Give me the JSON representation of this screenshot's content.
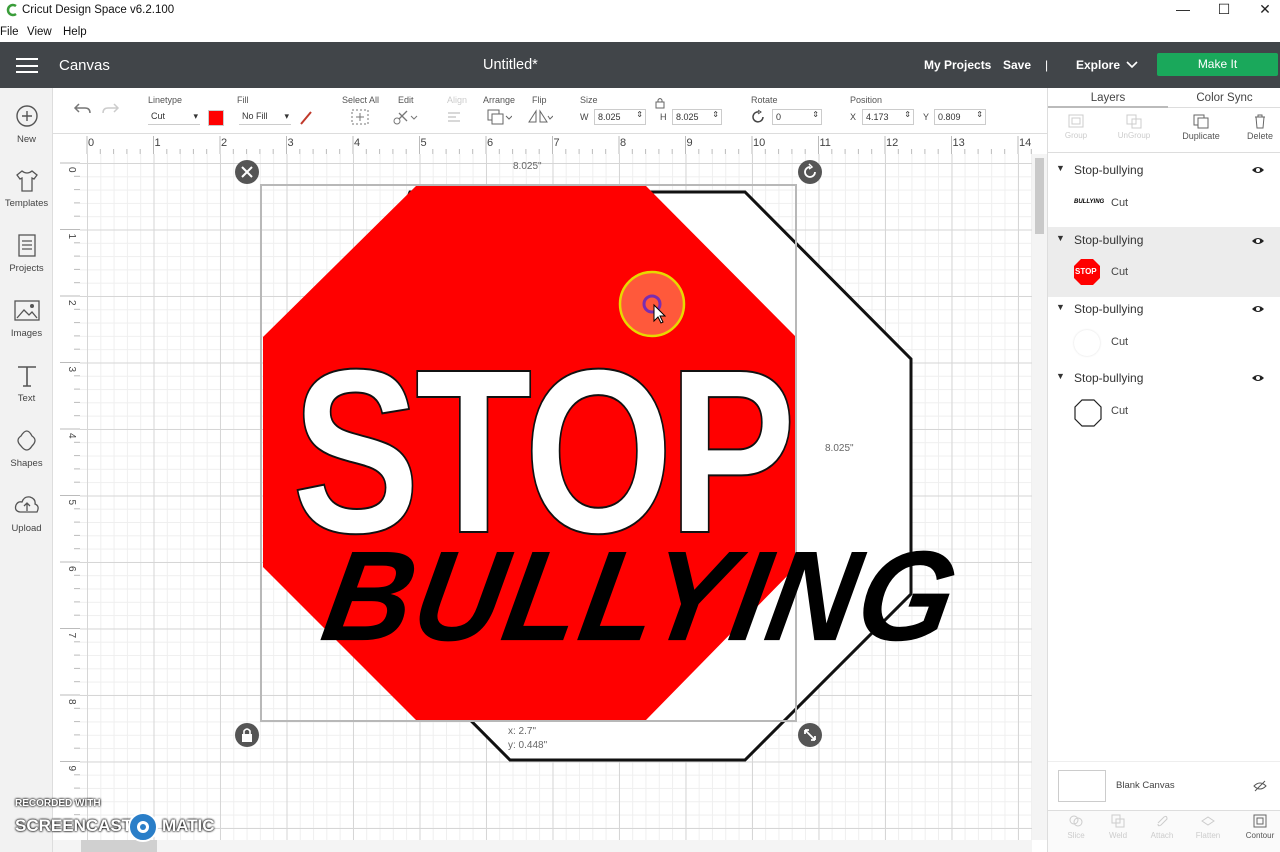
{
  "window": {
    "title": "Cricut Design Space  v6.2.100"
  },
  "menu": [
    "File",
    "View",
    "Help"
  ],
  "header": {
    "section": "Canvas",
    "document": "Untitled*",
    "my_projects": "My Projects",
    "save": "Save",
    "separator": "|",
    "explore": "Explore",
    "make_it": "Make It"
  },
  "sidebar": [
    {
      "label": "New",
      "icon": "plus-circle-icon"
    },
    {
      "label": "Templates",
      "icon": "tshirt-icon"
    },
    {
      "label": "Projects",
      "icon": "projects-icon"
    },
    {
      "label": "Images",
      "icon": "image-icon"
    },
    {
      "label": "Text",
      "icon": "text-icon"
    },
    {
      "label": "Shapes",
      "icon": "shapes-icon"
    },
    {
      "label": "Upload",
      "icon": "upload-icon"
    }
  ],
  "toolbar": {
    "linetype_label": "Linetype",
    "linetype_value": "Cut",
    "fill_label": "Fill",
    "fill_value": "No Fill",
    "select_all": "Select All",
    "edit": "Edit",
    "align": "Align",
    "arrange": "Arrange",
    "flip": "Flip",
    "size_label": "Size",
    "w_label": "W",
    "w_value": "8.025",
    "h_label": "H",
    "h_value": "8.025",
    "rotate_label": "Rotate",
    "rotate_value": "0",
    "position_label": "Position",
    "x_label": "X",
    "x_value": "4.173",
    "y_label": "Y",
    "y_value": "0.809",
    "linetype_color": "#ff0000"
  },
  "ruler": {
    "top": [
      "0",
      "1",
      "2",
      "3",
      "4",
      "5",
      "6",
      "7",
      "8",
      "9",
      "10",
      "11",
      "12",
      "13",
      "14"
    ],
    "left": [
      "0",
      "1",
      "2",
      "3",
      "4",
      "5",
      "6",
      "7",
      "8",
      "9"
    ]
  },
  "canvas": {
    "width_readout": "8.025\"",
    "height_readout": "8.025\"",
    "pos_x": "x: 2.7\"",
    "pos_y": "y: 0.448\"",
    "stop_text": "STOP",
    "bullying_text": "BULLYING",
    "red": "#ff0000"
  },
  "layers_panel": {
    "tab_layers": "Layers",
    "tab_color_sync": "Color Sync",
    "actions": [
      "Group",
      "UnGroup",
      "Duplicate",
      "Delete"
    ],
    "groups": [
      {
        "name": "Stop-bullying",
        "item": "Cut",
        "thumb": "BULLYING"
      },
      {
        "name": "Stop-bullying",
        "item": "Cut",
        "thumb": "STOP"
      },
      {
        "name": "Stop-bullying",
        "item": "Cut",
        "thumb": ""
      },
      {
        "name": "Stop-bullying",
        "item": "Cut",
        "thumb": ""
      }
    ],
    "blank_canvas": "Blank Canvas",
    "bottom_actions": [
      "Slice",
      "Weld",
      "Attach",
      "Flatten",
      "Contour"
    ]
  },
  "watermark": {
    "line1": "RECORDED WITH",
    "line2": "SCREENCAST",
    "line3": "MATIC"
  }
}
